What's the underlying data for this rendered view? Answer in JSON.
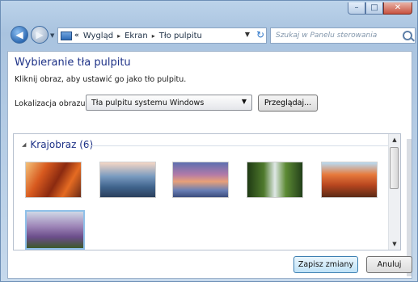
{
  "window": {
    "buttons": {
      "minimize": "–",
      "maximize": "□",
      "close": "✕"
    }
  },
  "nav": {
    "back_icon": "arrow-left",
    "forward_icon": "arrow-right",
    "breadcrumb": [
      "Wygląd",
      "Ekran",
      "Tło pulpitu"
    ],
    "breadcrumb_prefix": "«",
    "separator": "▸",
    "search_placeholder": "Szukaj w Panelu sterowania"
  },
  "main": {
    "heading": "Wybieranie tła pulpitu",
    "subtext": "Kliknij obraz, aby ustawić go jako tło pulpitu.",
    "location_label": "Lokalizacja obrazu:",
    "location_value": "Tła pulpitu systemu Windows",
    "browse_label": "Przeglądaj..."
  },
  "gallery": {
    "group_title": "Krajobraz (6)",
    "thumbnails": [
      "thumb-1",
      "thumb-2",
      "thumb-3",
      "thumb-4",
      "thumb-5",
      "thumb-6"
    ],
    "selected_index": 5
  },
  "footer": {
    "save_label": "Zapisz zmiany",
    "cancel_label": "Anuluj"
  }
}
